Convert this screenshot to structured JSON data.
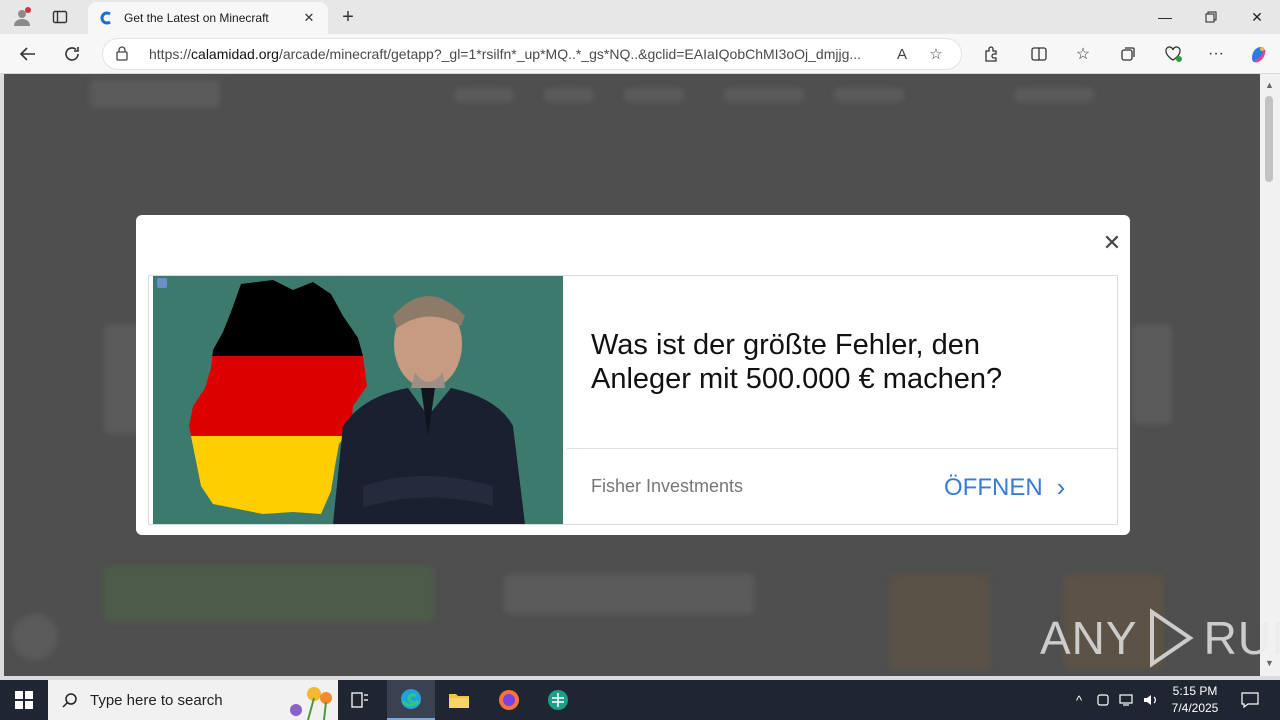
{
  "browser": {
    "tab_title": "Get the Latest on Minecraft",
    "url_host": "calamidad.org",
    "url_prefix": "https://",
    "url_rest": "/arcade/minecraft/getapp?_gl=1*rsilfn*_up*MQ..*_gs*NQ..&gclid=EAIaIQobChMI3oOj_dmjjg..."
  },
  "ad": {
    "headline": "Was ist der größte Fehler, den Anleger mit 500.000 € machen?",
    "advertiser": "Fisher Investments",
    "cta_label": "ÖFFNEN",
    "cta_chevron": "›"
  },
  "watermark": {
    "left": "ANY",
    "right": "RUN"
  },
  "taskbar": {
    "search_placeholder": "Type here to search",
    "time": "5:15 PM",
    "date": "7/4/2025"
  },
  "colors": {
    "accent": "#3a7bd5",
    "overlay": "#4f4f4f",
    "taskbar": "#1f2632"
  },
  "icons": [
    "profile-icon",
    "tab-actions-icon",
    "back-icon",
    "refresh-icon",
    "lock-icon",
    "read-aloud-icon",
    "favorite-star-icon",
    "extensions-icon",
    "split-screen-icon",
    "favorites-icon",
    "collections-icon",
    "browser-essentials-icon",
    "more-icon",
    "copilot-icon",
    "close-icon",
    "windows-start-icon",
    "search-icon",
    "task-view-icon",
    "edge-icon",
    "file-explorer-icon",
    "firefox-icon",
    "app-icon",
    "chevron-up-icon",
    "network-icon",
    "volume-icon",
    "notification-icon"
  ]
}
